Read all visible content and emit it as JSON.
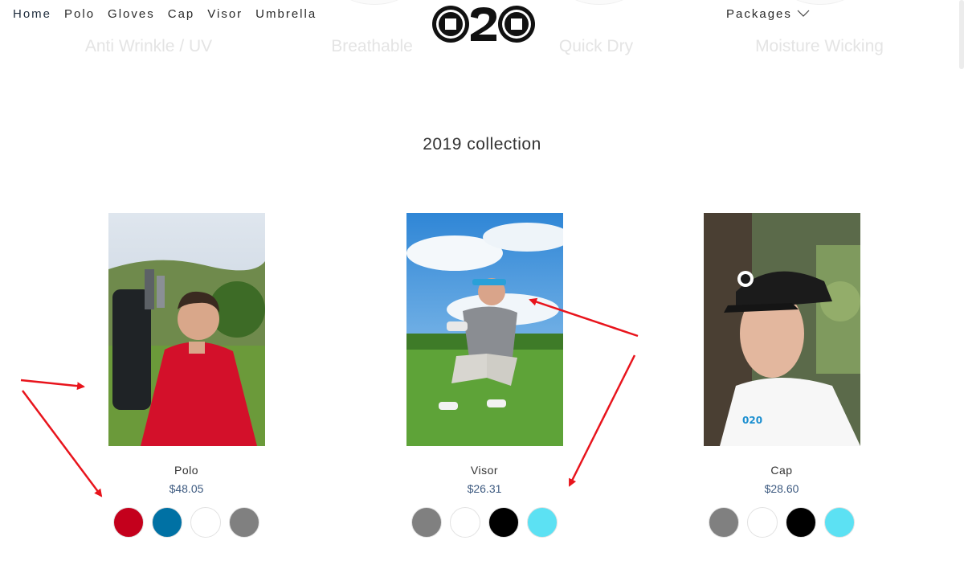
{
  "nav": {
    "items": [
      {
        "label": "Home"
      },
      {
        "label": "Polo"
      },
      {
        "label": "Gloves"
      },
      {
        "label": "Cap"
      },
      {
        "label": "Visor"
      },
      {
        "label": "Umbrella"
      }
    ],
    "packages_label": "Packages",
    "packages_icon": "chevron-down-icon"
  },
  "logo": {
    "text": "020"
  },
  "features": [
    {
      "label": "Anti Wrinkle / UV"
    },
    {
      "label": "Breathable"
    },
    {
      "label": "Quick Dry"
    },
    {
      "label": "Moisture Wicking"
    }
  ],
  "collection": {
    "title": "2019 collection",
    "products": [
      {
        "name": "Polo",
        "price": "$48.05",
        "swatches": [
          "#c4001c",
          "#0071a4",
          "#ffffff",
          "#808080"
        ]
      },
      {
        "name": "Visor",
        "price": "$26.31",
        "swatches": [
          "#808080",
          "#ffffff",
          "#000000",
          "#5ce1f3"
        ]
      },
      {
        "name": "Cap",
        "price": "$28.60",
        "swatches": [
          "#808080",
          "#ffffff",
          "#000000",
          "#5ce1f3"
        ]
      }
    ]
  },
  "annotation_color": "#e8141c"
}
